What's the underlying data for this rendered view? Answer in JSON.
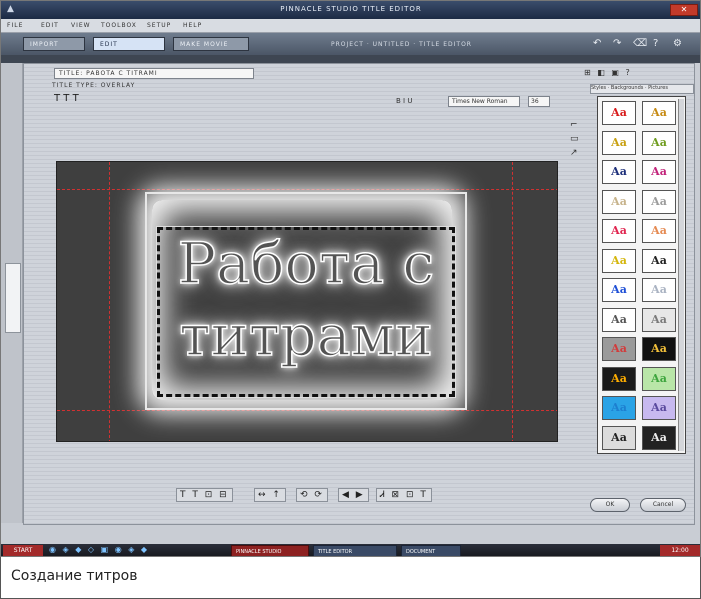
{
  "window": {
    "title": "PINNACLE STUDIO TITLE EDITOR",
    "close_label": "✕"
  },
  "menu": [
    "FILE",
    "EDIT",
    "VIEW",
    "TOOLBOX",
    "SETUP",
    "HELP"
  ],
  "tabs": [
    {
      "label": "IMPORT",
      "active": false
    },
    {
      "label": "EDIT",
      "active": true
    },
    {
      "label": "MAKE MOVIE",
      "active": false
    }
  ],
  "toolbar": {
    "path_text": "PROJECT · UNTITLED · TITLE EDITOR"
  },
  "dialog": {
    "title_name_value": "TITLE: PABOTA C TITRAMI",
    "title_type_label": "TITLE TYPE: OVERLAY",
    "style_buttons": "T  T  T",
    "topright_controls": "⊞ ◧ ▣ ?",
    "font_controls": "B I U",
    "font_name": "Times New Roman",
    "font_size": "36"
  },
  "canvas": {
    "title_line1": "Работа с",
    "title_line2": "титрами"
  },
  "gallery": {
    "header": "Styles  ·  Backgrounds  ·  Pictures",
    "thumb_text": "Aa",
    "thumbs": [
      {
        "color": "#d81b1b",
        "bg": "#ffffff"
      },
      {
        "color": "#c68a12",
        "bg": "#ffffff"
      },
      {
        "color": "#c8a011",
        "bg": "#ffffff"
      },
      {
        "color": "#6f9c1e",
        "bg": "#ffffff"
      },
      {
        "color": "#1d2f7a",
        "bg": "#ffffff"
      },
      {
        "color": "#c2237a",
        "bg": "#ffffff"
      },
      {
        "color": "#c7b38b",
        "bg": "#ffffff"
      },
      {
        "color": "#9c9c9c",
        "bg": "#ffffff"
      },
      {
        "color": "#e0244f",
        "bg": "#ffffff"
      },
      {
        "color": "#e58a52",
        "bg": "#ffffff"
      },
      {
        "color": "#d4b60c",
        "bg": "#ffffff"
      },
      {
        "color": "#222222",
        "bg": "#ffffff"
      },
      {
        "color": "#1e4fd6",
        "bg": "#ffffff"
      },
      {
        "color": "#aab3c2",
        "bg": "#ffffff"
      },
      {
        "color": "#555555",
        "bg": "#ffffff"
      },
      {
        "color": "#7a7a7a",
        "bg": "#e7e7e7"
      },
      {
        "color": "#d23b3b",
        "bg": "#9a9a9a"
      },
      {
        "color": "#f3c03a",
        "bg": "#111111"
      },
      {
        "color": "#ffae00",
        "bg": "#1a1a1a"
      },
      {
        "color": "#3da53d",
        "bg": "#b9e6a8"
      },
      {
        "color": "#1d7fd0",
        "bg": "#2aa3e6"
      },
      {
        "color": "#5a4a9e",
        "bg": "#c7b9ef"
      },
      {
        "color": "#222222",
        "bg": "#dcdcdc"
      },
      {
        "color": "#eeeeee",
        "bg": "#222222"
      }
    ]
  },
  "bottom_tools": [
    "T T ⊡ ⊟",
    "↔ ↑",
    "⟲ ⟳",
    "◀ ▶",
    "Ꮧ ⊠ ⊡ T"
  ],
  "buttons": {
    "ok": "OK",
    "cancel": "Cancel"
  },
  "taskbar": {
    "start": "START",
    "icons": "◉ ◈ ◆ ◇ ▣ ◉ ◈ ◆",
    "items": [
      "PINNACLE STUDIO",
      "TITLE EDITOR",
      "DOCUMENT"
    ],
    "clock": "12:00"
  },
  "caption": "Создание титров"
}
